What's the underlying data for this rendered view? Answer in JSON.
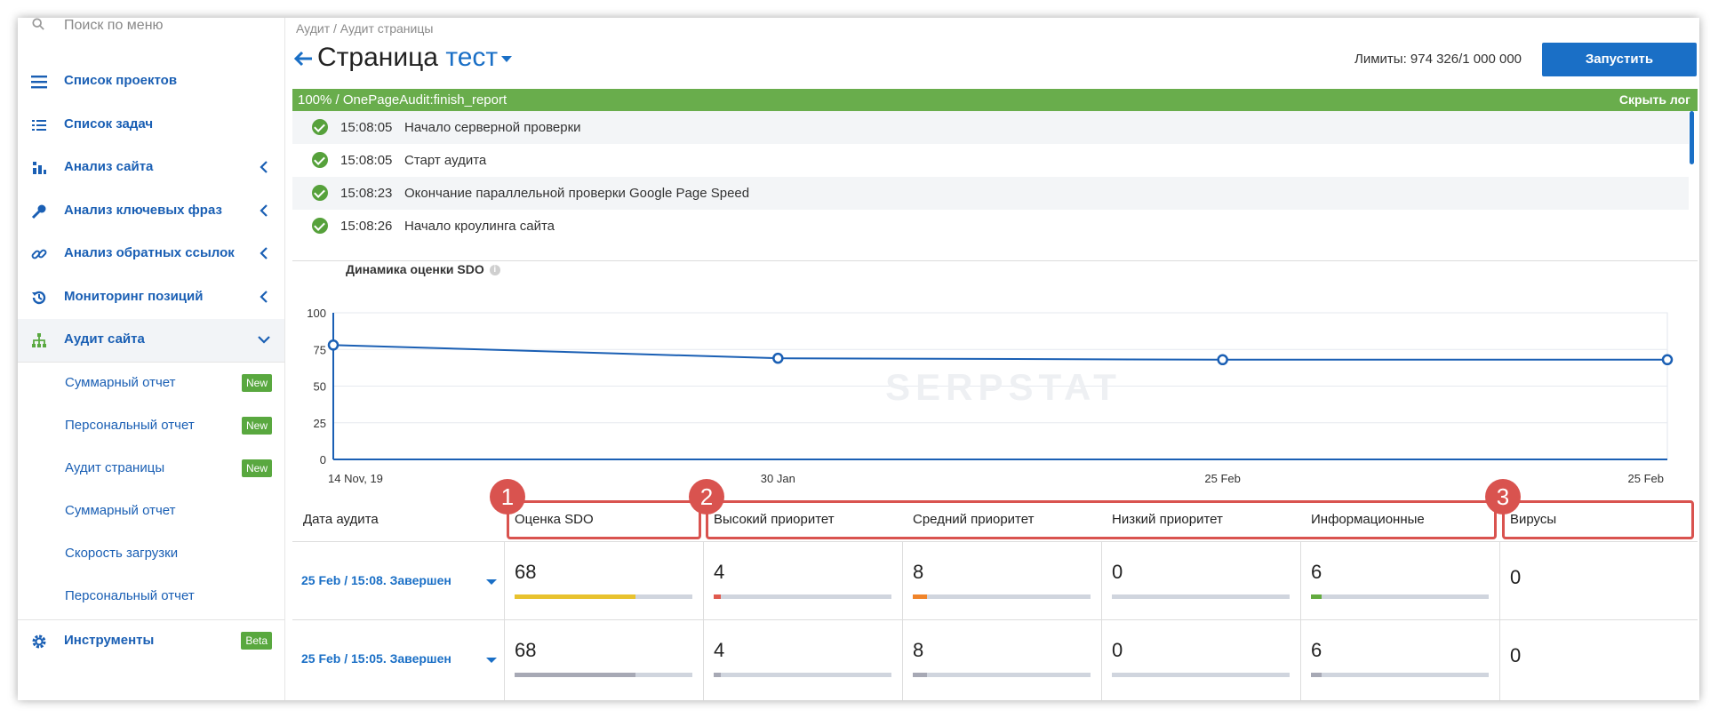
{
  "sidebar": {
    "search_placeholder": "Поиск по меню",
    "items": [
      {
        "label": "Список проектов",
        "icon": "menu-icon"
      },
      {
        "label": "Список задач",
        "icon": "list-icon"
      },
      {
        "label": "Анализ сайта",
        "icon": "site-analysis-icon"
      },
      {
        "label": "Анализ ключевых фраз",
        "icon": "key-icon"
      },
      {
        "label": "Анализ обратных ссылок",
        "icon": "link-icon"
      },
      {
        "label": "Мониторинг позиций",
        "icon": "history-icon"
      },
      {
        "label": "Аудит сайта",
        "icon": "sitemap-icon"
      }
    ],
    "subitems": [
      {
        "label": "Суммарный отчет",
        "badge": "New"
      },
      {
        "label": "Персональный отчет",
        "badge": "New"
      },
      {
        "label": "Аудит страницы",
        "badge": "New"
      },
      {
        "label": "Суммарный отчет"
      },
      {
        "label": "Скорость загрузки"
      },
      {
        "label": "Персональный отчет"
      }
    ],
    "tools": {
      "label": "Инструменты",
      "badge": "Beta",
      "icon": "gear-icon"
    }
  },
  "header": {
    "breadcrumb": "Аудит / Аудит страницы",
    "title": "Страница",
    "project": "тест",
    "limits": "Лимиты: 974 326/1 000 000",
    "run_button": "Запустить"
  },
  "progress": {
    "label": "100% / OnePageAudit:finish_report",
    "hide_log": "Скрыть лог",
    "percent": 100
  },
  "log": [
    {
      "time": "15:08:05",
      "message": "Начало серверной проверки"
    },
    {
      "time": "15:08:05",
      "message": "Старт аудита"
    },
    {
      "time": "15:08:23",
      "message": "Окончание параллельной проверки Google Page Speed"
    },
    {
      "time": "15:08:26",
      "message": "Начало кроулинга сайта"
    }
  ],
  "chart_data": {
    "type": "line",
    "title": "Динамика оценки SDO",
    "x": [
      "14 Nov, 19",
      "30 Jan",
      "25 Feb",
      "25 Feb"
    ],
    "values": [
      78,
      69,
      68,
      68
    ],
    "ylim": [
      0,
      100
    ],
    "yticks": [
      "100",
      "75",
      "50",
      "25",
      "0"
    ],
    "grid": true,
    "watermark": "SERPSTAT",
    "color": "#1a5fb4"
  },
  "table": {
    "headers": [
      "Дата аудита",
      "Оценка SDO",
      "Высокий приоритет",
      "Средний приоритет",
      "Низкий приоритет",
      "Информационные",
      "Вирусы"
    ],
    "rows": [
      {
        "date": "25 Feb / 15:08. Завершен",
        "sdo": "68",
        "high": "4",
        "medium": "8",
        "low": "0",
        "info": "6",
        "viruses": "0"
      },
      {
        "date": "25 Feb / 15:05. Завершен",
        "sdo": "68",
        "high": "4",
        "medium": "8",
        "low": "0",
        "info": "6",
        "viruses": "0"
      }
    ],
    "colors": {
      "sdo_active": "#e8c22e",
      "sdo_inactive": "#a7a9b5",
      "high": "#e05a4e",
      "medium": "#f0842a",
      "info": "#63ab3f",
      "muted": "#a7a9b5"
    }
  },
  "annotations": [
    "1",
    "2",
    "3"
  ]
}
